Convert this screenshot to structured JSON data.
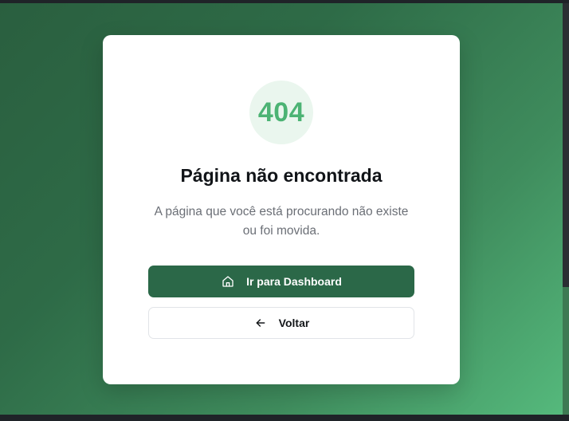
{
  "error": {
    "code": "404",
    "title": "Página não encontrada",
    "message": "A página que você está procurando não existe ou foi movida."
  },
  "actions": {
    "primary_label": "Ir para Dashboard",
    "primary_icon": "home-icon",
    "secondary_label": "Voltar",
    "secondary_icon": "arrow-left-icon"
  },
  "colors": {
    "accent": "#4cb374",
    "primary_button": "#2b6848",
    "background_start": "#2a5f3f",
    "background_end": "#55b97c"
  }
}
